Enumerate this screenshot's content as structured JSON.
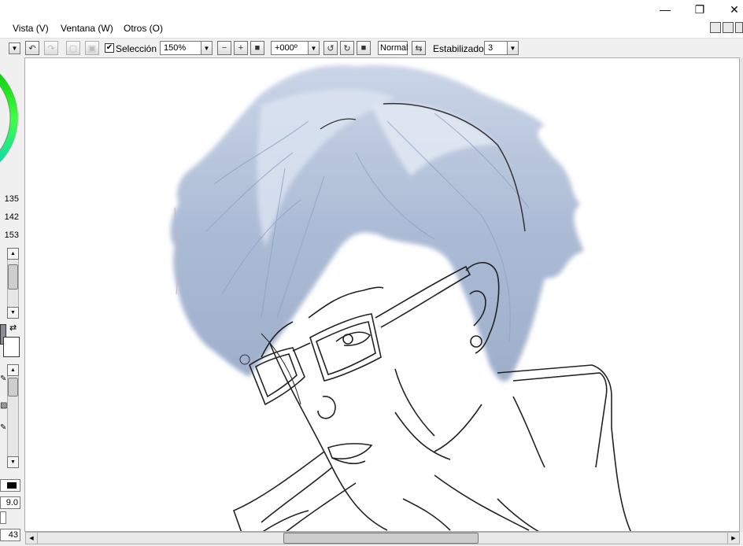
{
  "menubar": {
    "items": [
      {
        "label": "Vista (V)"
      },
      {
        "label": "Ventana (W)"
      },
      {
        "label": "Otros (O)"
      }
    ]
  },
  "titlebar": {
    "minimize": "—",
    "restore": "❐",
    "close": "✕"
  },
  "toolbar": {
    "selection_label": "Selección",
    "selection_checked": "✔",
    "zoom_value": "150%",
    "rotation_value": "+000º",
    "blend_mode": "Normal",
    "stabilizer_label": "Estabilizador",
    "stabilizer_value": "3"
  },
  "color_panel": {
    "r": "135",
    "g": "142",
    "b": "153",
    "current_color": "#878e99"
  },
  "left_panel": {
    "brush_size": "9.0",
    "density": "43"
  },
  "colors": {
    "hair": "#b4c3dc",
    "frame_accent": "#d8a070"
  }
}
